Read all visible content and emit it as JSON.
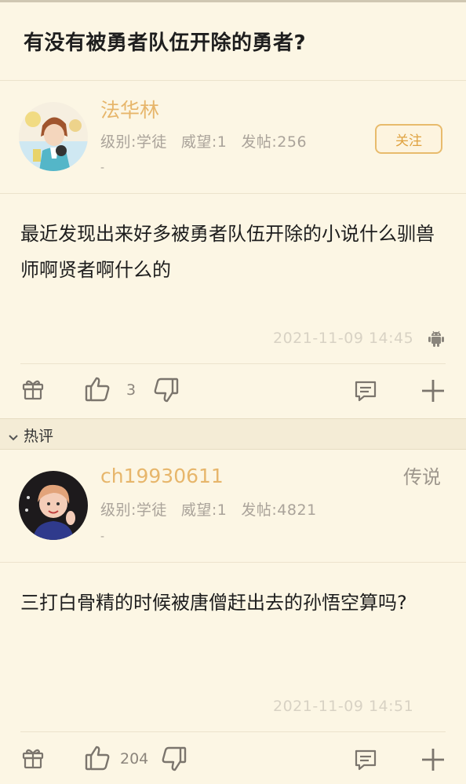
{
  "page": {
    "title": "有没有被勇者队伍开除的勇者?"
  },
  "post": {
    "author": {
      "name": "法华林",
      "level_label": "级别:学徒",
      "prestige_label": "威望:1",
      "posts_label": "发帖:256",
      "extra": "-"
    },
    "follow_label": "关注",
    "content": "最近发现出来好多被勇者队伍开除的小说什么驯兽师啊贤者啊什么的",
    "timestamp": "2021-11-09 14:45",
    "device_icon": "android-icon",
    "like_count": "3"
  },
  "section": {
    "label": "热评"
  },
  "comment": {
    "author": {
      "name": "ch19930611",
      "level_label": "级别:学徒",
      "prestige_label": "威望:1",
      "posts_label": "发帖:4821",
      "extra": "-"
    },
    "rank": "传说",
    "content": "三打白骨精的时候被唐僧赶出去的孙悟空算吗?",
    "timestamp": "2021-11-09 14:51",
    "like_count": "204"
  },
  "colors": {
    "background": "#fcf6e4",
    "username": "#e7b66b",
    "follow_border": "#e8bb6c",
    "meta": "#aaa39a",
    "timestamp": "#d8d2c4"
  },
  "icons": [
    "gift-icon",
    "thumbs-up-icon",
    "thumbs-down-icon",
    "comment-icon",
    "plus-icon",
    "android-icon",
    "chevron-down-icon"
  ]
}
